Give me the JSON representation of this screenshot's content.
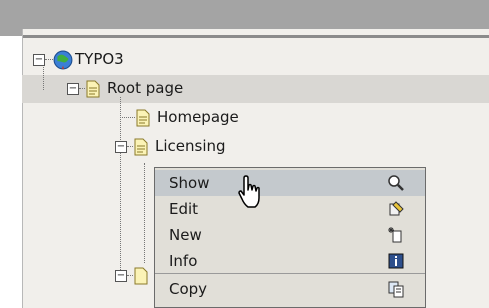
{
  "tree": {
    "root": {
      "label": "TYPO3",
      "icon": "globe-icon"
    },
    "items": [
      {
        "label": "Root page",
        "icon": "page-icon"
      },
      {
        "label": "Homepage",
        "icon": "page-icon"
      },
      {
        "label": "Licensing",
        "icon": "page-icon"
      }
    ]
  },
  "context_menu": {
    "items": [
      {
        "label": "Show",
        "icon": "magnifier-icon"
      },
      {
        "label": "Edit",
        "icon": "edit-icon"
      },
      {
        "label": "New",
        "icon": "new-icon"
      },
      {
        "label": "Info",
        "icon": "info-icon"
      },
      {
        "label": "Copy",
        "icon": "copy-icon"
      }
    ]
  }
}
